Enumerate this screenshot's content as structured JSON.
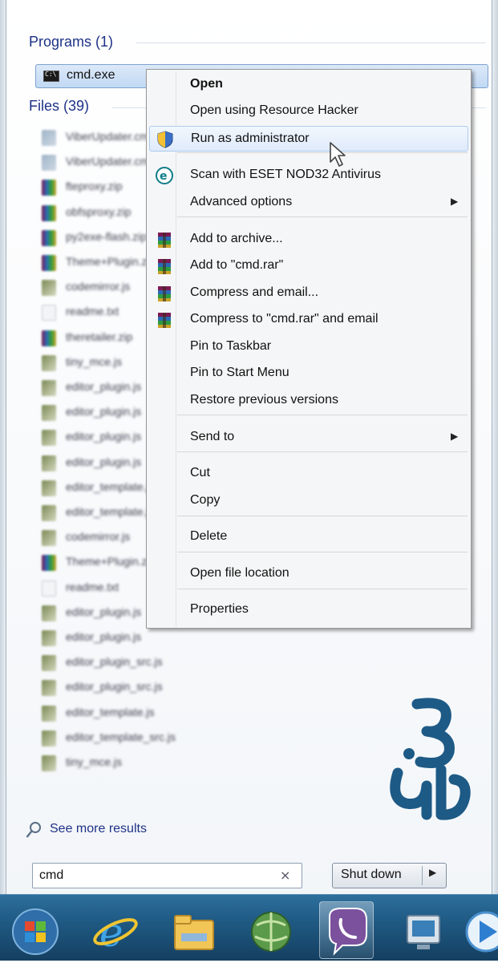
{
  "start_menu": {
    "programs_header": "Programs (1)",
    "files_header": "Files (39)",
    "program_items": [
      {
        "label": "cmd.exe",
        "icon": "cmd-icon"
      }
    ],
    "file_items": [
      {
        "label": "ViberUpdater.cmd",
        "icon": "viber-file-icon"
      },
      {
        "label": "ViberUpdater.cmd",
        "icon": "viber-file-icon"
      },
      {
        "label": "fteproxy.zip",
        "icon": "winrar-archive-icon"
      },
      {
        "label": "obfsproxy.zip",
        "icon": "winrar-archive-icon"
      },
      {
        "label": "py2exe-flash.zip",
        "icon": "winrar-archive-icon"
      },
      {
        "label": "Theme+Plugin.zip",
        "icon": "winrar-archive-icon"
      },
      {
        "label": "codemirror.js",
        "icon": "js-file-icon"
      },
      {
        "label": "readme.txt",
        "icon": "text-file-icon"
      },
      {
        "label": "theretailer.zip",
        "icon": "winrar-archive-icon"
      },
      {
        "label": "tiny_mce.js",
        "icon": "js-file-icon"
      },
      {
        "label": "editor_plugin.js",
        "icon": "js-file-icon"
      },
      {
        "label": "editor_plugin.js",
        "icon": "js-file-icon"
      },
      {
        "label": "editor_plugin.js",
        "icon": "js-file-icon"
      },
      {
        "label": "editor_plugin.js",
        "icon": "js-file-icon"
      },
      {
        "label": "editor_template.js",
        "icon": "js-file-icon"
      },
      {
        "label": "editor_template.js",
        "icon": "js-file-icon"
      },
      {
        "label": "codemirror.js",
        "icon": "js-file-icon"
      },
      {
        "label": "Theme+Plugin.zip",
        "icon": "winrar-archive-icon"
      },
      {
        "label": "readme.txt",
        "icon": "text-file-icon"
      },
      {
        "label": "editor_plugin.js",
        "icon": "js-file-icon"
      },
      {
        "label": "editor_plugin.js",
        "icon": "js-file-icon"
      },
      {
        "label": "editor_plugin_src.js",
        "icon": "js-file-icon"
      },
      {
        "label": "editor_plugin_src.js",
        "icon": "js-file-icon"
      },
      {
        "label": "editor_template.js",
        "icon": "js-file-icon"
      },
      {
        "label": "editor_template_src.js",
        "icon": "js-file-icon"
      },
      {
        "label": "tiny_mce.js",
        "icon": "js-file-icon"
      }
    ],
    "see_more": "See more results",
    "search": {
      "value": "cmd",
      "clear": "×"
    },
    "shutdown": {
      "label": "Shut down",
      "arrow": "▶"
    }
  },
  "context_menu": {
    "items": [
      {
        "label": "Open",
        "bold": true
      },
      {
        "label": "Open using Resource Hacker"
      },
      {
        "label": "Run as administrator",
        "icon": "uac-shield-icon",
        "hover": true
      },
      {
        "label": "Scan with ESET NOD32 Antivirus",
        "icon": "eset-icon"
      },
      {
        "label": "Advanced options",
        "submenu": true
      },
      {
        "label": "Add to archive...",
        "icon": "winrar-icon"
      },
      {
        "label": "Add to \"cmd.rar\"",
        "icon": "winrar-icon"
      },
      {
        "label": "Compress and email...",
        "icon": "winrar-icon"
      },
      {
        "label": "Compress to \"cmd.rar\" and email",
        "icon": "winrar-icon"
      },
      {
        "label": "Pin to Taskbar"
      },
      {
        "label": "Pin to Start Menu"
      },
      {
        "label": "Restore previous versions"
      },
      {
        "label": "Send to",
        "submenu": true
      },
      {
        "label": "Cut"
      },
      {
        "label": "Copy"
      },
      {
        "label": "Delete"
      },
      {
        "label": "Open file location"
      },
      {
        "label": "Properties"
      }
    ],
    "submenu_arrow": "▶"
  },
  "taskbar": {
    "buttons": [
      {
        "icon": "windows-start-orb-icon"
      },
      {
        "icon": "internet-explorer-icon"
      },
      {
        "icon": "file-explorer-icon"
      },
      {
        "icon": "network-globe-icon"
      },
      {
        "icon": "viber-icon",
        "active": true
      },
      {
        "icon": "remote-desktop-icon"
      },
      {
        "icon": "media-player-icon"
      }
    ]
  },
  "colors": {
    "header_blue": "#1e3287",
    "taskbar": "#1f5a84",
    "logo": "#1d5a86"
  }
}
